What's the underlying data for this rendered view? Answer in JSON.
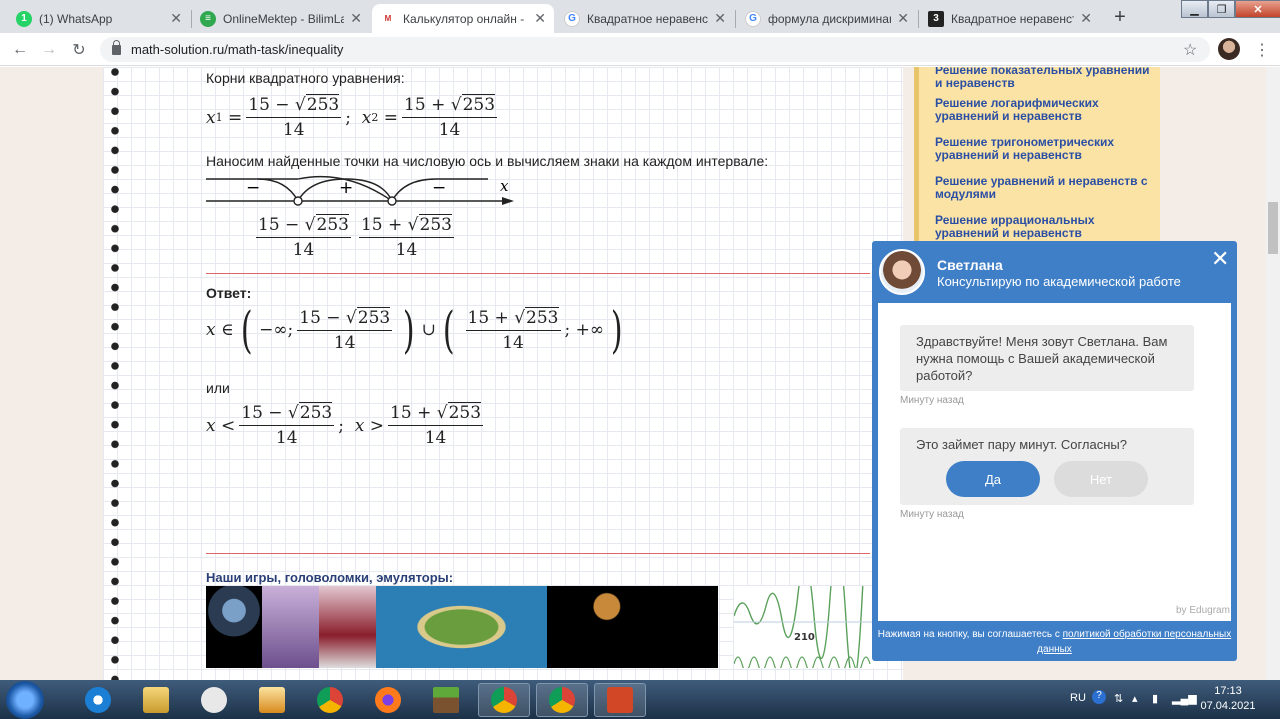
{
  "browser": {
    "tabs": [
      {
        "title": "(1) WhatsApp",
        "icon": "whatsapp-icon",
        "active": false
      },
      {
        "title": "OnlineMektep - BilimLand",
        "icon": "onlinemektep-icon",
        "active": false
      },
      {
        "title": "Калькулятор онлайн - Р",
        "icon": "math-solution-icon",
        "active": true
      },
      {
        "title": "Квадратное неравенство",
        "icon": "google-icon",
        "active": false
      },
      {
        "title": "формула дискриминанта",
        "icon": "google-icon",
        "active": false
      },
      {
        "title": "Квадратное неравенство",
        "icon": "tab-3-icon",
        "active": false
      }
    ],
    "url": "math-solution.ru/math-task/inequality"
  },
  "content": {
    "roots_label": "Корни квадратного уравнения:",
    "x1": "x",
    "x1_sub": "1",
    "x2_sub": "2",
    "numer_minus": "15 − √253",
    "numer_plus": "15 + √253",
    "denom": "14",
    "sqrt_val": "253",
    "fifteen_minus": "15 −",
    "fifteen_plus": "15 +",
    "intervals_label": "Наносим найденные точки на числовую ось и вычисляем знаки на каждом интервале:",
    "axis_var": "x",
    "signs": [
      "−",
      "+",
      "−"
    ],
    "answer_label": "Ответ:",
    "or_label": "или",
    "neg_inf": "−∞;",
    "pos_inf": "+∞",
    "games_title": "Наши игры, головоломки, эмуляторы:",
    "game_counter": "210"
  },
  "sidebar": {
    "links": [
      "Решение показательных уравнений и неравенств",
      "Решение логарифмических уравнений и неравенств",
      "Решение тригонометрических уравнений и неравенств",
      "Решение уравнений и неравенств с модулями",
      "Решение иррациональных уравнений и неравенств"
    ]
  },
  "chat": {
    "name": "Светлана",
    "role": "Консультирую по академической работе",
    "message1": "Здравствуйте! Меня зовут Светлана. Вам нужна помощь с Вашей академической работой?",
    "time1": "Минуту назад",
    "message2": "Это займет пару минут. Согласны?",
    "yes": "Да",
    "no": "Нет",
    "time2": "Минуту назад",
    "by": "by Edugram",
    "footer_text": "Нажимая на кнопку, вы соглашаетесь с ",
    "footer_link": "политикой обработки персональных данных"
  },
  "taskbar": {
    "lang": "RU",
    "time": "17:13",
    "date": "07.04.2021"
  },
  "colors": {
    "chat_blue": "#3f7fc7",
    "sidebar_bg": "#fbe3a6",
    "link_blue": "#2b4fa3",
    "red_rule": "#dd6666"
  }
}
